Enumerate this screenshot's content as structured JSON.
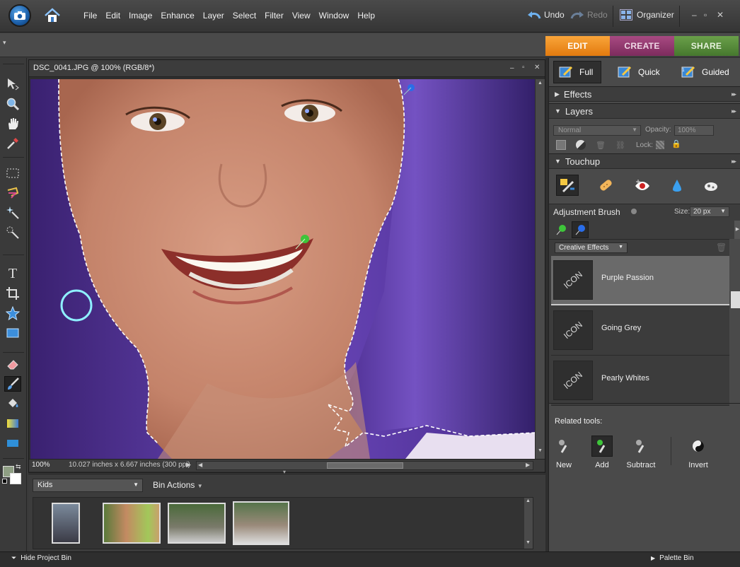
{
  "menubar": {
    "items": [
      "File",
      "Edit",
      "Image",
      "Enhance",
      "Layer",
      "Select",
      "Filter",
      "View",
      "Window",
      "Help"
    ],
    "undo": "Undo",
    "redo": "Redo",
    "organizer": "Organizer"
  },
  "mode_tabs": {
    "edit": "EDIT",
    "create": "CREATE",
    "share": "SHARE"
  },
  "document": {
    "title": "DSC_0041.JPG @ 100% (RGB/8*)",
    "zoom": "100%",
    "dimensions": "10.027 inches x 6.667 inches (300 ppi)"
  },
  "project_bin": {
    "album": "Kids",
    "bin_actions": "Bin Actions",
    "thumbnail_count": 4
  },
  "bottom": {
    "hide_bin": "Hide Project Bin",
    "palette_bin": "Palette Bin"
  },
  "right_panel": {
    "views": [
      "Full",
      "Quick",
      "Guided"
    ],
    "effects_header": "Effects",
    "layers_header": "Layers",
    "blend_mode": "Normal",
    "opacity_label": "Opacity:",
    "opacity_value": "100%",
    "lock_label": "Lock:",
    "touchup_header": "Touchup",
    "adjustment_brush": "Adjustment Brush",
    "size_label": "Size:",
    "size_value": "20 px",
    "category": "Creative Effects",
    "effects": [
      {
        "label": "Purple Passion",
        "thumb": "ICON"
      },
      {
        "label": "Going Grey",
        "thumb": "ICON"
      },
      {
        "label": "Pearly Whites",
        "thumb": "ICON"
      }
    ],
    "related_tools_label": "Related tools:",
    "related_tools": [
      "New",
      "Add",
      "Subtract",
      "Invert"
    ]
  },
  "colors": {
    "edit_tab": "#f08c1a",
    "create_tab": "#96376f",
    "share_tab": "#5a8a3a",
    "hair_purple": "#5b3aa0",
    "brush_cursor": "#8ff0ff"
  }
}
